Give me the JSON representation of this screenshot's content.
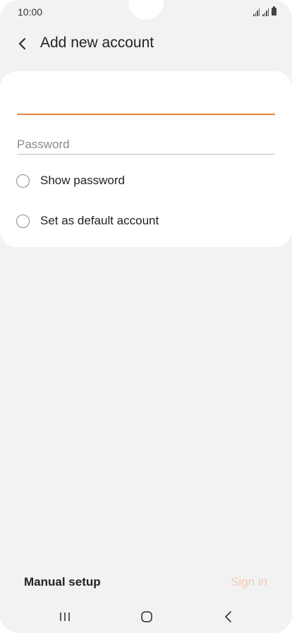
{
  "status_bar": {
    "time": "10:00"
  },
  "header": {
    "title": "Add new account",
    "back_icon": "chevron-left-icon"
  },
  "form": {
    "email": {
      "value": "",
      "placeholder": ""
    },
    "password": {
      "value": "",
      "placeholder": "Password"
    },
    "options": [
      {
        "label": "Show password",
        "checked": false
      },
      {
        "label": "Set as default account",
        "checked": false
      }
    ]
  },
  "actions": {
    "manual_setup_label": "Manual setup",
    "sign_in_label": "Sign in"
  },
  "navigation": {
    "recents_icon": "recents-icon",
    "home_icon": "home-icon",
    "back_icon": "back-icon"
  },
  "colors": {
    "accent": "#e8853d",
    "sign_in_disabled": "#f6c9b3",
    "background": "#f2f2f2",
    "card": "#ffffff"
  }
}
